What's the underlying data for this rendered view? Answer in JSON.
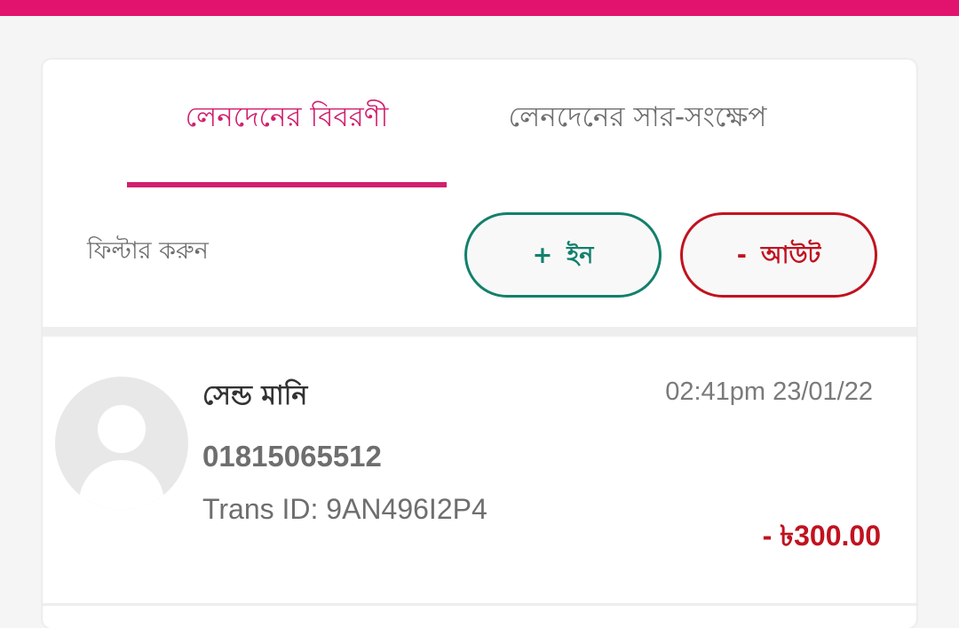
{
  "colors": {
    "brand": "#e2136e",
    "tab_active": "#d11f6e",
    "in": "#12806c",
    "out": "#c1121f"
  },
  "tabs": [
    {
      "label": "লেনদেনের বিবরণী",
      "active": true
    },
    {
      "label": "লেনদেনের সার-সংক্ষেপ",
      "active": false
    }
  ],
  "filter": {
    "label": "ফিল্টার করুন",
    "in_symbol": "+",
    "in_label": "ইন",
    "out_symbol": "-",
    "out_label": "আউট"
  },
  "transactions": [
    {
      "avatar_icon": "person-icon",
      "type": "সেন্ড মানি",
      "time": "02:41pm 23/01/22",
      "number": "01815065512",
      "trans_id": "Trans ID: 9AN496I2P4",
      "amount": "- ৳300.00"
    }
  ]
}
